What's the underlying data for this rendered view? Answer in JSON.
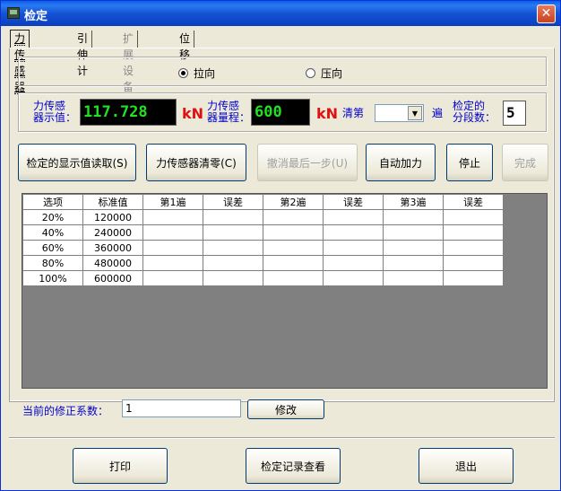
{
  "window": {
    "title": "检定",
    "close_glyph": "✕"
  },
  "tabs": [
    {
      "label": "力传感器",
      "active": true,
      "disabled": false
    },
    {
      "label": "引伸计",
      "active": false,
      "disabled": false
    },
    {
      "label": "扩展设备",
      "active": false,
      "disabled": true
    },
    {
      "label": "位 移",
      "active": false,
      "disabled": false
    }
  ],
  "mode": {
    "tension_label": "拉向",
    "compression_label": "压向",
    "selected": "tension"
  },
  "readout": {
    "display_label": "力传感\n器示值：",
    "display_value": "117.728",
    "display_unit": "kN",
    "range_label": "力传感\n器量程：",
    "range_value": "600",
    "range_unit": "kN",
    "clear_label": "清第",
    "clear_select_value": "",
    "pass_label": "遍",
    "segments_label": "检定的\n分段数：",
    "segments_value": "5"
  },
  "actions": {
    "read_display": "检定的显示值读取(S)",
    "zero_sensor": "力传感器清零(C)",
    "undo_last": "撤消最后一步(U)",
    "auto_load": "自动加力",
    "stop": "停止",
    "finish": "完成"
  },
  "table": {
    "headers": [
      "选项",
      "标准值",
      "第1遍",
      "误差",
      "第2遍",
      "误差",
      "第3遍",
      "误差"
    ],
    "rows": [
      [
        "20%",
        "120000",
        "",
        "",
        "",
        "",
        "",
        ""
      ],
      [
        "40%",
        "240000",
        "",
        "",
        "",
        "",
        "",
        ""
      ],
      [
        "60%",
        "360000",
        "",
        "",
        "",
        "",
        "",
        ""
      ],
      [
        "80%",
        "480000",
        "",
        "",
        "",
        "",
        "",
        ""
      ],
      [
        "100%",
        "600000",
        "",
        "",
        "",
        "",
        "",
        ""
      ]
    ]
  },
  "correction": {
    "label": "当前的修正系数：",
    "value": "1",
    "modify_button": "修改"
  },
  "footer": {
    "print_button": "打印",
    "records_button": "检定记录查看",
    "exit_button": "退出"
  },
  "colors": {
    "lcd_text": "#22E022",
    "unit_red": "#E01010",
    "label_blue": "#0000CC",
    "title_blue": "#0A5FE8"
  }
}
